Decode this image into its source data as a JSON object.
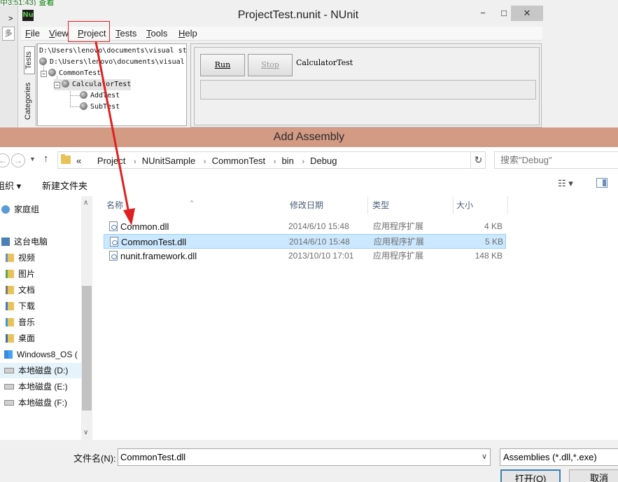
{
  "nunit": {
    "top_strip": {
      "time": "中3:51:43)",
      "link": "查看"
    },
    "left_edge": {
      "arrow": ">",
      "btn": "多"
    },
    "logo": "Nu",
    "title": "ProjectTest.nunit - NUnit",
    "window_buttons": {
      "min": "−",
      "max": "□",
      "close": "✕"
    },
    "menu": [
      {
        "label": "File",
        "u": "F",
        "rest": "ile"
      },
      {
        "label": "View",
        "u": "V",
        "rest": "iew"
      },
      {
        "label": "Project",
        "u": "P",
        "rest": "roject"
      },
      {
        "label": "Tests",
        "u": "T",
        "rest": "ests"
      },
      {
        "label": "Tools",
        "u": "T",
        "rest": "ools"
      },
      {
        "label": "Help",
        "u": "H",
        "rest": "elp"
      }
    ],
    "side_tabs": {
      "tests": "Tests",
      "categories": "Categories"
    },
    "tree": [
      "D:\\Users\\lenovo\\documents\\visual st",
      "D:\\Users\\lenovo\\documents\\visual",
      "CommonTest",
      "CalculatorTest",
      "AddTest",
      "SubTest"
    ],
    "run_button": "Run",
    "stop_button": "Stop",
    "current_test": "CalculatorTest"
  },
  "dialog": {
    "title": "Add Assembly",
    "breadcrumb": [
      "Project",
      "NUnitSample",
      "CommonTest",
      "bin",
      "Debug"
    ],
    "breadcrumb_prefix": "«",
    "search_placeholder": "搜索\"Debug\"",
    "organize": "组织 ▾",
    "new_folder": "新建文件夹",
    "view_icon": "☷ ▾",
    "nav": [
      {
        "label": "家庭组",
        "icon": "homegroup-icon"
      },
      {
        "label": "这台电脑",
        "icon": "computer-icon"
      },
      {
        "label": "视频",
        "icon": "video-folder-icon"
      },
      {
        "label": "图片",
        "icon": "pictures-folder-icon"
      },
      {
        "label": "文档",
        "icon": "documents-folder-icon"
      },
      {
        "label": "下载",
        "icon": "downloads-folder-icon"
      },
      {
        "label": "音乐",
        "icon": "music-folder-icon"
      },
      {
        "label": "桌面",
        "icon": "desktop-folder-icon"
      },
      {
        "label": "Windows8_OS (",
        "icon": "windows-drive-icon"
      },
      {
        "label": "本地磁盘 (D:)",
        "icon": "drive-icon"
      },
      {
        "label": "本地磁盘 (E:)",
        "icon": "drive-icon"
      },
      {
        "label": "本地磁盘 (F:)",
        "icon": "drive-icon"
      }
    ],
    "columns": [
      "名称",
      "修改日期",
      "类型",
      "大小"
    ],
    "files": [
      {
        "name": "Common.dll",
        "date": "2014/6/10 15:48",
        "type": "应用程序扩展",
        "size": "4 KB"
      },
      {
        "name": "CommonTest.dll",
        "date": "2014/6/10 15:48",
        "type": "应用程序扩展",
        "size": "5 KB",
        "selected": true
      },
      {
        "name": "nunit.framework.dll",
        "date": "2013/10/10 17:01",
        "type": "应用程序扩展",
        "size": "148 KB"
      }
    ],
    "filename_label": "文件名(N):",
    "filename_value": "CommonTest.dll",
    "filter": "Assemblies (*.dll,*.exe)",
    "open_button": "打开(O)",
    "cancel_button": "取消"
  },
  "colors": {
    "dialog_title_bg": "#d39a84",
    "selection_bg": "#cce8ff",
    "annotation_red": "#e02020"
  }
}
